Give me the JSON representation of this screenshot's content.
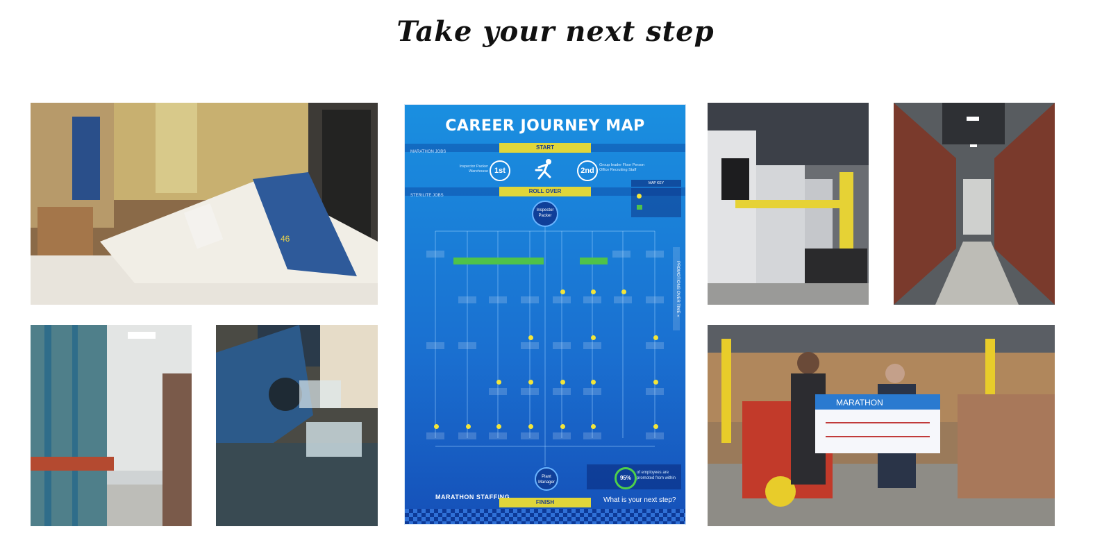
{
  "heading": "Take your next step",
  "photos": [
    {
      "name": "conveyor-photo"
    },
    {
      "name": "molding-machines-photo"
    },
    {
      "name": "warehouse-aisle-photo"
    },
    {
      "name": "racking-aisle-photo"
    },
    {
      "name": "conveyor-closeup-photo"
    },
    {
      "name": "referral-check-photo"
    }
  ],
  "career_map": {
    "title": "CAREER JOURNEY MAP",
    "marathon_jobs_label": "MARATHON JOBS",
    "start_label": "START",
    "first_badge": "1st",
    "second_badge": "2nd",
    "first_text": "Inspector Packer Warehouse",
    "second_text": "Group leader Floor Person Office Recruiting Staff",
    "sterilite_jobs_label": "STERILITE JOBS",
    "roll_over_label": "ROLL OVER",
    "map_key_label": "MAP KEY",
    "inspector_packer": "Inspector Packer",
    "promotions_label": "PROMOTIONS OVER TIME »",
    "plant_manager": "Plant Manager",
    "stat_percent": "95%",
    "stat_text": "of employees are promoted from within",
    "finish_label": "FINISH",
    "brand": "MARATHON STAFFING",
    "cta": "What is your next step?"
  }
}
